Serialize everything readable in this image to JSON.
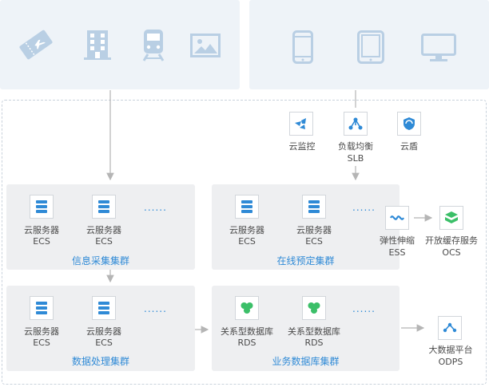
{
  "top_left_icons": [
    "ticket-icon",
    "building-icon",
    "train-icon",
    "image-icon"
  ],
  "top_right_icons": [
    "phone-icon",
    "tablet-icon",
    "monitor-icon"
  ],
  "services": {
    "monitor": "云监控",
    "slb_cn": "负载均衡",
    "slb_en": "SLB",
    "shield": "云盾"
  },
  "clusters": {
    "info": {
      "title": "信息采集集群",
      "n1": "云服务器",
      "n1e": "ECS",
      "n2": "云服务器",
      "n2e": "ECS",
      "dots": "......"
    },
    "online": {
      "title": "在线预定集群",
      "n1": "云服务器",
      "n1e": "ECS",
      "n2": "云服务器",
      "n2e": "ECS",
      "dots": "......"
    },
    "data": {
      "title": "数据处理集群",
      "n1": "云服务器",
      "n1e": "ECS",
      "n2": "云服务器",
      "n2e": "ECS",
      "dots": "......"
    },
    "biz": {
      "title": "业务数据库集群",
      "n1": "关系型数据库",
      "n1e": "RDS",
      "n2": "关系型数据库",
      "n2e": "RDS",
      "dots": "......"
    }
  },
  "side": {
    "ess_cn": "弹性伸缩",
    "ess_en": "ESS",
    "ocs_cn": "开放缓存服务",
    "ocs_en": "OCS",
    "odps_cn": "大数据平台",
    "odps_en": "ODPS"
  },
  "colors": {
    "accent": "#2f8ad6",
    "icon_gray": "#b9cfe4",
    "green": "#3bbf68",
    "panel": "#eef3f8",
    "cluster": "#eeeff1"
  }
}
